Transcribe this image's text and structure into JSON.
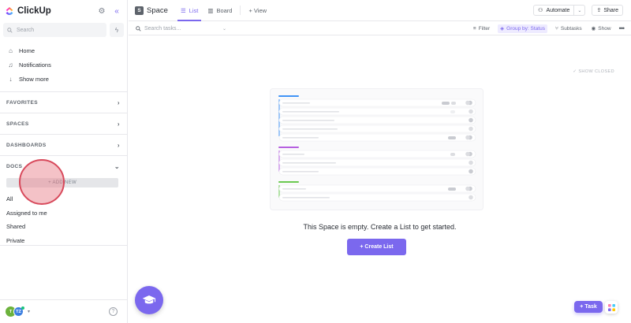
{
  "app": {
    "name": "ClickUp"
  },
  "sidebar": {
    "search_placeholder": "Search",
    "nav": [
      {
        "label": "Home",
        "icon": "home-icon"
      },
      {
        "label": "Notifications",
        "icon": "bell-icon"
      },
      {
        "label": "Show more",
        "icon": "arrow-down-icon"
      }
    ],
    "sections": {
      "favorites": "FAVORITES",
      "spaces": "SPACES",
      "dashboards": "DASHBOARDS",
      "docs": "DOCS"
    },
    "add_new": "+ ADD NEW",
    "docs_items": [
      "All",
      "Assigned to me",
      "Shared",
      "Private"
    ],
    "footer": {
      "avatar1": "T",
      "avatar2": "TZ"
    }
  },
  "topbar": {
    "space_initial": "S",
    "space_name": "Space",
    "tabs": [
      {
        "label": "List",
        "active": true
      },
      {
        "label": "Board",
        "active": false
      }
    ],
    "add_view": "+ View",
    "automate": "Automate",
    "share": "Share"
  },
  "toolbar": {
    "search_placeholder": "Search tasks...",
    "filter": "Filter",
    "group_by": "Group by: Status",
    "subtasks": "Subtasks",
    "show": "Show"
  },
  "main": {
    "show_closed": "SHOW CLOSED",
    "empty_message": "This Space is empty. Create a List to get started.",
    "create_list": "+ Create List"
  },
  "fab": {
    "task": "Task"
  },
  "colors": {
    "accent": "#7b68ee",
    "illus_blue": "#4194f6",
    "illus_purple": "#b660e0",
    "illus_green": "#6bc950"
  }
}
